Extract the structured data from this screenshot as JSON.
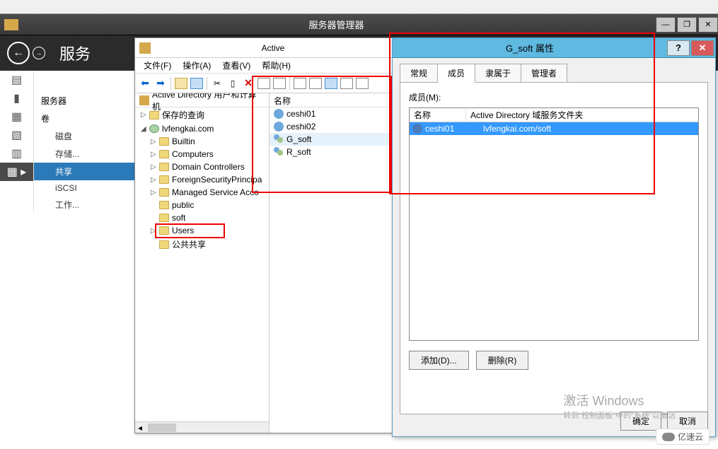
{
  "topWindow": {
    "title": "服务器管理器"
  },
  "nav": {
    "title": "服务"
  },
  "sidebar": {
    "items": [
      {
        "label": "服务器",
        "type": "head"
      },
      {
        "label": "卷",
        "type": "head"
      },
      {
        "label": "磁盘",
        "type": "sub"
      },
      {
        "label": "存储...",
        "type": "sub"
      },
      {
        "label": "共享",
        "type": "sub",
        "active": true
      },
      {
        "label": "iSCSI",
        "type": "sub"
      },
      {
        "label": "工作...",
        "type": "sub"
      }
    ]
  },
  "adWindow": {
    "titlePartial": "Active",
    "menus": [
      "文件(F)",
      "操作(A)",
      "查看(V)",
      "帮助(H)"
    ],
    "treeHeader": "Active Directory 用户和计算机",
    "listHeader": "名称",
    "tree": [
      {
        "label": "保存的查询",
        "level": 1,
        "exp": "▷",
        "icon": "folder"
      },
      {
        "label": "lvfengkai.com",
        "level": 1,
        "exp": "◢",
        "icon": "globe"
      },
      {
        "label": "Builtin",
        "level": 2,
        "exp": "▷",
        "icon": "folder"
      },
      {
        "label": "Computers",
        "level": 2,
        "exp": "▷",
        "icon": "folder"
      },
      {
        "label": "Domain Controllers",
        "level": 2,
        "exp": "▷",
        "icon": "folder"
      },
      {
        "label": "ForeignSecurityPrincipa",
        "level": 2,
        "exp": "▷",
        "icon": "folder"
      },
      {
        "label": "Managed Service Acco",
        "level": 2,
        "exp": "▷",
        "icon": "folder"
      },
      {
        "label": "public",
        "level": 2,
        "exp": "",
        "icon": "folder"
      },
      {
        "label": "soft",
        "level": 2,
        "exp": "",
        "icon": "folder"
      },
      {
        "label": "Users",
        "level": 2,
        "exp": "▷",
        "icon": "folder"
      },
      {
        "label": "公共共享",
        "level": 2,
        "exp": "",
        "icon": "folder"
      }
    ],
    "list": [
      {
        "label": "ceshi01",
        "type": "user"
      },
      {
        "label": "ceshi02",
        "type": "user"
      },
      {
        "label": "G_soft",
        "type": "group",
        "sel": true
      },
      {
        "label": "R_soft",
        "type": "group"
      }
    ]
  },
  "propDialog": {
    "title": "G_soft 属性",
    "tabs": [
      "常规",
      "成员",
      "隶属于",
      "管理者"
    ],
    "activeTabIdx": 1,
    "membersLabel": "成员(M):",
    "col1": "名称",
    "col2": "Active Directory 域服务文件夹",
    "rows": [
      {
        "name": "ceshi01",
        "path": "lvfengkai.com/soft",
        "sel": true
      }
    ],
    "addBtn": "添加(D)...",
    "removeBtn": "删除(R)",
    "okBtn": "确定",
    "cancelBtn": "取消"
  },
  "watermark": {
    "line1": "激活 Windows",
    "line2": "转到\"控制面板\"中的\"系统\"以激活"
  },
  "logo": "亿速云"
}
